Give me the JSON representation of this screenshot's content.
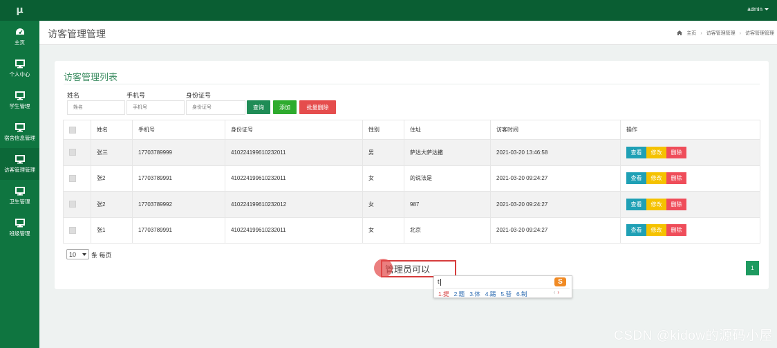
{
  "app": {
    "logo": "μ",
    "user_menu": "admin"
  },
  "sidebar": {
    "items": [
      {
        "label": "主页",
        "icon": "dashboard-icon"
      },
      {
        "label": "个人中心",
        "icon": "monitor-icon"
      },
      {
        "label": "学生管理",
        "icon": "monitor-icon"
      },
      {
        "label": "宿舍信息管理",
        "icon": "monitor-icon"
      },
      {
        "label": "访客管理管理",
        "icon": "monitor-icon"
      },
      {
        "label": "卫生管理",
        "icon": "monitor-icon"
      },
      {
        "label": "班级管理",
        "icon": "monitor-icon"
      }
    ]
  },
  "page": {
    "title": "访客管理管理",
    "breadcrumb": [
      "主页",
      "访客管理管理",
      "访客管理管理"
    ]
  },
  "card": {
    "title": "访客管理列表"
  },
  "filters": {
    "name": {
      "label": "姓名",
      "placeholder": "姓名"
    },
    "phone": {
      "label": "手机号",
      "placeholder": "手机号"
    },
    "idcard": {
      "label": "身份证号",
      "placeholder": "身份证号"
    }
  },
  "buttons": {
    "search": "查询",
    "add": "添加",
    "batch_delete": "批量删除"
  },
  "table": {
    "headers": [
      "姓名",
      "手机号",
      "身份证号",
      "性别",
      "住址",
      "访客时间",
      "操作"
    ],
    "rows": [
      {
        "name": "张三",
        "phone": "17703789999",
        "idcard": "410224199610232011",
        "gender": "男",
        "address": "萨达大萨达撒",
        "time": "2021-03-20 13:46:58"
      },
      {
        "name": "张2",
        "phone": "17703789991",
        "idcard": "410224199610232011",
        "gender": "女",
        "address": "的说法是",
        "time": "2021-03-20 09:24:27"
      },
      {
        "name": "张2",
        "phone": "17703789992",
        "idcard": "410224199610232012",
        "gender": "女",
        "address": "987",
        "time": "2021-03-20 09:24:27"
      },
      {
        "name": "张1",
        "phone": "17703789991",
        "idcard": "410224199610232011",
        "gender": "女",
        "address": "北京",
        "time": "2021-03-20 09:24:27"
      }
    ],
    "actions": {
      "view": "查看",
      "edit": "修改",
      "delete": "删除"
    }
  },
  "pager": {
    "page_size": "10",
    "page_size_suffix": "条 每页",
    "current_page": "1"
  },
  "ime": {
    "typed_text": "管理员可以",
    "composition": "t",
    "candidates": [
      "1.提",
      "2.题",
      "3.体",
      "4.踢",
      "5.替",
      "6.制"
    ],
    "nav": [
      "‹",
      "›"
    ],
    "logo": "S"
  },
  "watermark": "CSDN @kidow的源码小屋",
  "colors": {
    "sidebar": "#0f7540",
    "topbar": "#0a5e33",
    "search_button": "#1f8c56",
    "add_button": "#2eab2e",
    "batch_delete_button": "#e54d4d",
    "view_button": "#1fa0b5",
    "edit_button": "#f5c200",
    "delete_button": "#ef4d5a"
  }
}
